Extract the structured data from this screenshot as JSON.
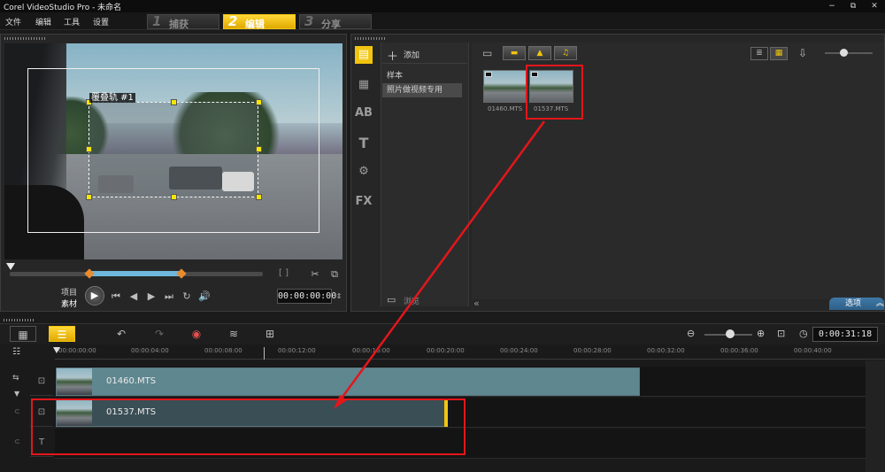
{
  "window": {
    "title": "Corel VideoStudio Pro - 未命名",
    "controls": [
      "−",
      "⧉",
      "✕"
    ]
  },
  "menu": {
    "items": [
      "文件",
      "编辑",
      "工具",
      "设置"
    ]
  },
  "steps": [
    {
      "num": "1",
      "label": "捕获",
      "active": false
    },
    {
      "num": "2",
      "label": "编辑",
      "active": true
    },
    {
      "num": "3",
      "label": "分享",
      "active": false
    }
  ],
  "preview": {
    "overlay_label": "覆叠轨 #1",
    "mode_project": "项目",
    "mode_clip": "素材",
    "timecode": "00:00:00:00",
    "trim_marks": "[ ]"
  },
  "library": {
    "add_label": "添加",
    "folders": [
      "样本",
      "照片做视频专用"
    ],
    "browse_label": "浏览",
    "side_icons": [
      "media-icon",
      "instant-project-icon",
      "transition-icon",
      "title-icon",
      "graphic-icon",
      "filter-icon"
    ],
    "side_glyphs": {
      "transition": "AB",
      "title": "T",
      "filter": "FX"
    },
    "thumbnails": [
      {
        "name": "01460.MTS"
      },
      {
        "name": "01537.MTS"
      }
    ],
    "options_label": "选项"
  },
  "timeline": {
    "timecode": "0:00:31:18",
    "ruler_ticks": [
      "00:00:00:00",
      "00:00:04:00",
      "00:00:08:00",
      "00:00:12:00",
      "00:00:16:00",
      "00:00:20:00",
      "00:00:24:00",
      "00:00:28:00",
      "00:00:32:00",
      "00:00:36:00",
      "00:00:40:00"
    ],
    "tracks": [
      {
        "clip": "01460.MTS"
      },
      {
        "clip": "01537.MTS"
      }
    ],
    "text_track_glyph": "T",
    "tool_glyphs": [
      "↶",
      "↷"
    ]
  },
  "colors": {
    "accent": "#f1c40f",
    "annotation": "#e3161b",
    "clip_main": "#5f8790",
    "clip_overlay": "#3a4e55"
  }
}
